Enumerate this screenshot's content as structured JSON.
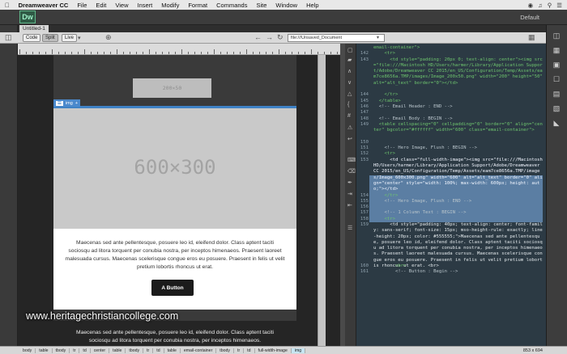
{
  "menubar": {
    "app": "Dreamweaver CC",
    "items": [
      "File",
      "Edit",
      "View",
      "Insert",
      "Modify",
      "Format",
      "Commands",
      "Site",
      "Window",
      "Help"
    ]
  },
  "app_logo": "Dw",
  "workspace": "Default",
  "doc_tab": "Untitled-1",
  "toolbar": {
    "code": "Code",
    "split": "Split",
    "live": "Live",
    "address": "file:///Unsaved_Document"
  },
  "live": {
    "logo_placeholder": "200×50",
    "hero_placeholder": "600×300",
    "img_tag": "img",
    "body_text": "Maecenas sed ante pellentesque, posuere leo id, eleifend dolor. Class aptent taciti sociosqu ad litora torquent per conubia nostra, per inceptos himenaeos. Praesent laoreet malesuada cursus. Maecenas scelerisque congue eros eu posuere. Praesent in felis ut velit pretium lobortis rhoncus ut erat.",
    "button": "A Button",
    "body_text2": "Maecenas sed ante pellentesque, posuere leo id, eleifend dolor. Class aptent taciti sociosqu ad litora torquent per conubia nostra, per inceptos himenaeos."
  },
  "watermark": "www.heritagechristiancollege.com",
  "code": {
    "lines": [
      {
        "n": "",
        "text": "email-container\">",
        "k": "t"
      },
      {
        "n": "142",
        "text": "    <tr>",
        "k": "t"
      },
      {
        "n": "143",
        "text": "      <td style=\"padding: 20px 0; text-align: center\"><img src=\"file:///Macintosh HD/Users/harmer/Library/Application Support/Adobe/Dreamweaver CC 2015/en_US/Configuration/Temp/Assets/eam7ce8656a.TMP/images/Image_200x50.png\" width=\"200\" height=\"50\" alt=\"alt_text\" border=\"0\"></td>",
        "k": "t"
      },
      {
        "n": "144",
        "text": "    </tr>",
        "k": "t"
      },
      {
        "n": "145",
        "text": "  </table>",
        "k": "t"
      },
      {
        "n": "146",
        "text": "  <!-- Email Header : END -->",
        "k": "c"
      },
      {
        "n": "147",
        "text": "",
        "k": "c"
      },
      {
        "n": "148",
        "text": "  <!-- Email Body : BEGIN -->",
        "k": "c"
      },
      {
        "n": "149",
        "text": "  <table cellspacing=\"0\" cellpadding=\"0\" border=\"0\" align=\"center\" bgcolor=\"#ffffff\" width=\"600\" class=\"email-container\">",
        "k": "t"
      },
      {
        "n": "150",
        "text": "",
        "k": "c"
      },
      {
        "n": "151",
        "text": "    <!-- Hero Image, Flush : BEGIN -->",
        "k": "c"
      },
      {
        "n": "152",
        "text": "    <tr>",
        "k": "t"
      },
      {
        "n": "153",
        "text": "      <td class=\"full-width-image\"><img src=\"file:///Macintosh HD/Users/harmer/Library/Application Support/Adobe/Dreamweaver CC 2015/en_US/Configuration/Temp/Assets/eam7ce8656a.TMP/images/Image_600x300.png\" width=\"600\" alt=\"alt_text\" border=\"0\" align=\"center\" style=\"width: 100%; max-width: 600px; height: auto;\"></td>",
        "k": "s"
      },
      {
        "n": "154",
        "text": "    </tr>",
        "k": "t"
      },
      {
        "n": "155",
        "text": "    <!-- Hero Image, Flush : END -->",
        "k": "c"
      },
      {
        "n": "156",
        "text": "",
        "k": "c"
      },
      {
        "n": "157",
        "text": "    <!-- 1 Column Text : BEGIN -->",
        "k": "c"
      },
      {
        "n": "158",
        "text": "    <tr>",
        "k": "t"
      },
      {
        "n": "159",
        "text": "      <td style=\"padding: 40px; text-align: center; font-family: sans-serif; font-size: 15px; mso-height-rule: exactly; line-height: 20px; color: #555555;\">Maecenas sed ante pellentesque, posuere leo id, eleifend dolor. Class aptent taciti sociosqu ad litora torquent per conubia nostra, per inceptos himenaeos. Praesent laoreet malesuada cursus. Maecenas scelerisque congue eros eu posuere. Praesent in felis ut velit pretium lobortis rhoncus ut erat. <br>",
        "k": "w"
      },
      {
        "n": "160",
        "text": "        <br>",
        "k": "t"
      },
      {
        "n": "161",
        "text": "        <!-- Button : Begin -->",
        "k": "c"
      }
    ]
  },
  "status": {
    "crumbs": [
      "body",
      "table",
      "tbody",
      "tr",
      "td",
      "center",
      "table",
      "tbody",
      "tr",
      "td",
      "table",
      "email-container",
      "tbody",
      "tr",
      "td",
      "full-width-image",
      "img"
    ],
    "size": "853 x 694"
  }
}
